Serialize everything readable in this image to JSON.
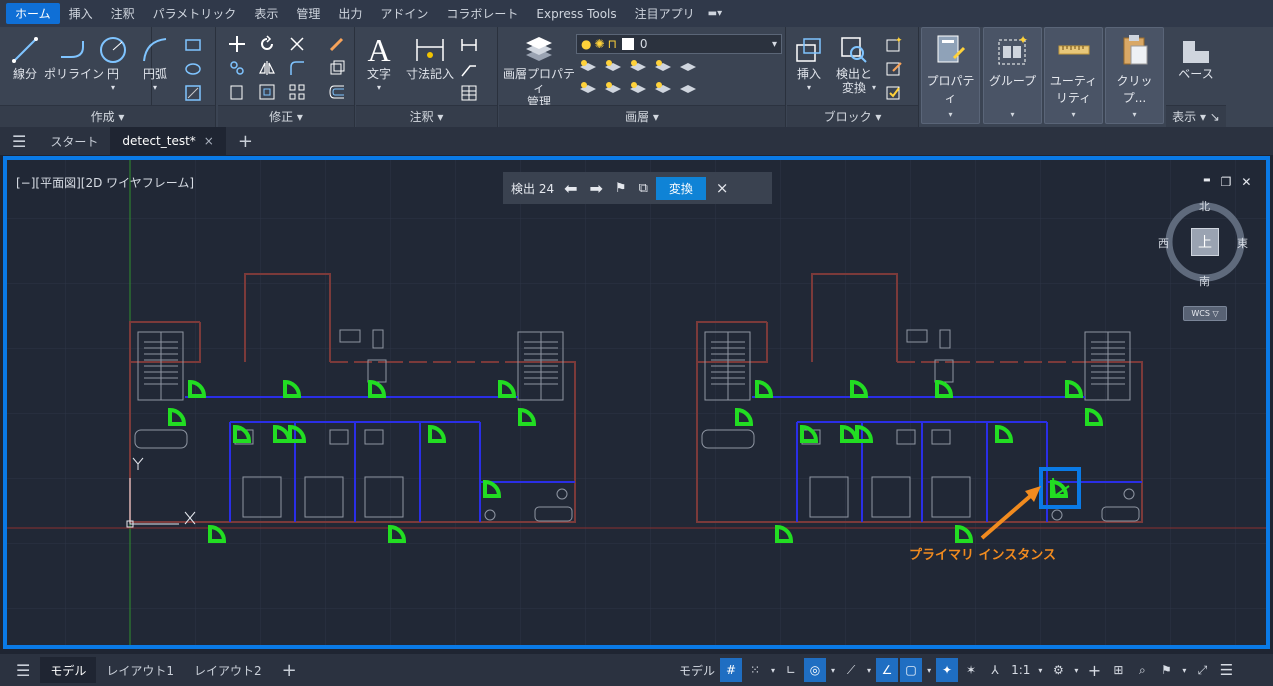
{
  "menu": [
    "ホーム",
    "挿入",
    "注釈",
    "パラメトリック",
    "表示",
    "管理",
    "出力",
    "アドイン",
    "コラボレート",
    "Express Tools",
    "注目アプリ"
  ],
  "ribbon": {
    "draw": {
      "title": "作成 ▾",
      "tools": [
        "線分",
        "ポリライン",
        "円",
        "円弧"
      ],
      "arrows": [
        "▾",
        "▾"
      ]
    },
    "modify": {
      "title": "修正 ▾"
    },
    "annotation": {
      "title": "注釈 ▾",
      "tools": [
        "文字",
        "寸法記入"
      ],
      "arrows": [
        "▾",
        "▾"
      ]
    },
    "layers": {
      "title": "画層 ▾",
      "tool": "画層プロパティ\n管理",
      "layer_value": "0",
      "layer_dropdown_arrow": "▾"
    },
    "block": {
      "title": "ブロック ▾",
      "tools": [
        "挿入",
        "検出と\n変換"
      ],
      "arrows": [
        "▾",
        "▾"
      ]
    },
    "big": [
      "プロパティ",
      "グループ",
      "ユーティリティ",
      "クリップ..."
    ],
    "big_arrow": "▾",
    "view": {
      "label": "ベース",
      "title": "表示 ▾ ↘"
    }
  },
  "tabs": {
    "menu_icon": "☰",
    "start": "スタート",
    "active": "detect_test*",
    "close": "×",
    "add": "+"
  },
  "viewport": {
    "label": "[−][平面図][2D ワイヤフレーム]",
    "find": {
      "label": "検出 24",
      "convert": "変換",
      "close": "×"
    },
    "window_controls": [
      "▬",
      "❐",
      "✕"
    ],
    "compass": {
      "n": "北",
      "s": "南",
      "e": "東",
      "w": "西",
      "top": "上"
    },
    "wcs": "WCS ▽",
    "annotation": "プライマリ インスタンス",
    "ucs": {
      "x": "X",
      "y": "Y"
    }
  },
  "status": {
    "layouts": [
      "モデル",
      "レイアウト1",
      "レイアウト2"
    ],
    "add": "+",
    "menu_icon": "☰",
    "tools": [
      "モデル",
      "#",
      "⁙",
      "▾",
      "∟",
      "◎",
      "▾",
      "⟋",
      "▾",
      "∠",
      "▢",
      "▾",
      "✦",
      "✶",
      "⅄",
      "1:1",
      "▾",
      "⚙",
      "▾",
      "+",
      "⊞",
      "⌕",
      "⚑",
      "▾",
      "⤢",
      "☰"
    ]
  },
  "colors": {
    "accent": "#0a7ae6",
    "door": "#22dd22",
    "wall": "#7b3a3a",
    "blue_line": "#2a2ee6",
    "annotation": "#f18b1f"
  }
}
